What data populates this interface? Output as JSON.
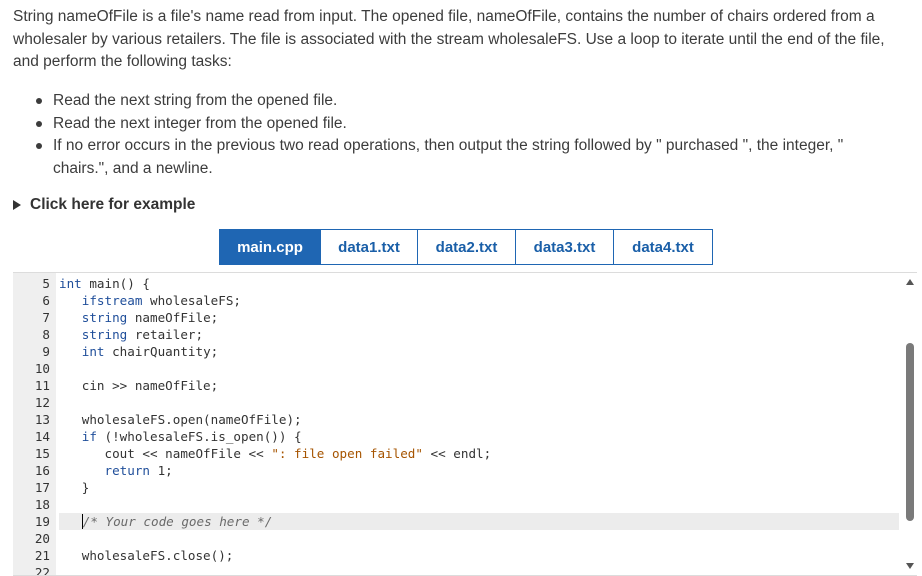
{
  "prompt": {
    "intro": "String nameOfFile is a file's name read from input. The opened file, nameOfFile, contains the number of chairs ordered from a wholesaler by various retailers. The file is associated with the stream wholesaleFS. Use a loop to iterate until the end of the file, and perform the following tasks:",
    "tasks": [
      "Read the next string from the opened file.",
      "Read the next integer from the opened file.",
      "If no error occurs in the previous two read operations, then output the string followed by \" purchased \", the integer, \" chairs.\", and a newline."
    ]
  },
  "example_toggle": "Click here for example",
  "tabs": [
    {
      "label": "main.cpp",
      "active": true
    },
    {
      "label": "data1.txt",
      "active": false
    },
    {
      "label": "data2.txt",
      "active": false
    },
    {
      "label": "data3.txt",
      "active": false
    },
    {
      "label": "data4.txt",
      "active": false
    }
  ],
  "editor": {
    "lines": [
      {
        "num": "5",
        "code": "int main() {"
      },
      {
        "num": "6",
        "code": "   ifstream wholesaleFS;"
      },
      {
        "num": "7",
        "code": "   string nameOfFile;"
      },
      {
        "num": "8",
        "code": "   string retailer;"
      },
      {
        "num": "9",
        "code": "   int chairQuantity;"
      },
      {
        "num": "10",
        "code": ""
      },
      {
        "num": "11",
        "code": "   cin >> nameOfFile;"
      },
      {
        "num": "12",
        "code": ""
      },
      {
        "num": "13",
        "code": "   wholesaleFS.open(nameOfFile);"
      },
      {
        "num": "14",
        "code": "   if (!wholesaleFS.is_open()) {"
      },
      {
        "num": "15",
        "code": "      cout << nameOfFile << \": file open failed\" << endl;"
      },
      {
        "num": "16",
        "code": "      return 1;"
      },
      {
        "num": "17",
        "code": "   }"
      },
      {
        "num": "18",
        "code": ""
      },
      {
        "num": "19",
        "code": "   /* Your code goes here */"
      },
      {
        "num": "20",
        "code": ""
      },
      {
        "num": "21",
        "code": "   wholesaleFS.close();"
      },
      {
        "num": "22",
        "code": ""
      }
    ],
    "current_line_index": 14
  }
}
